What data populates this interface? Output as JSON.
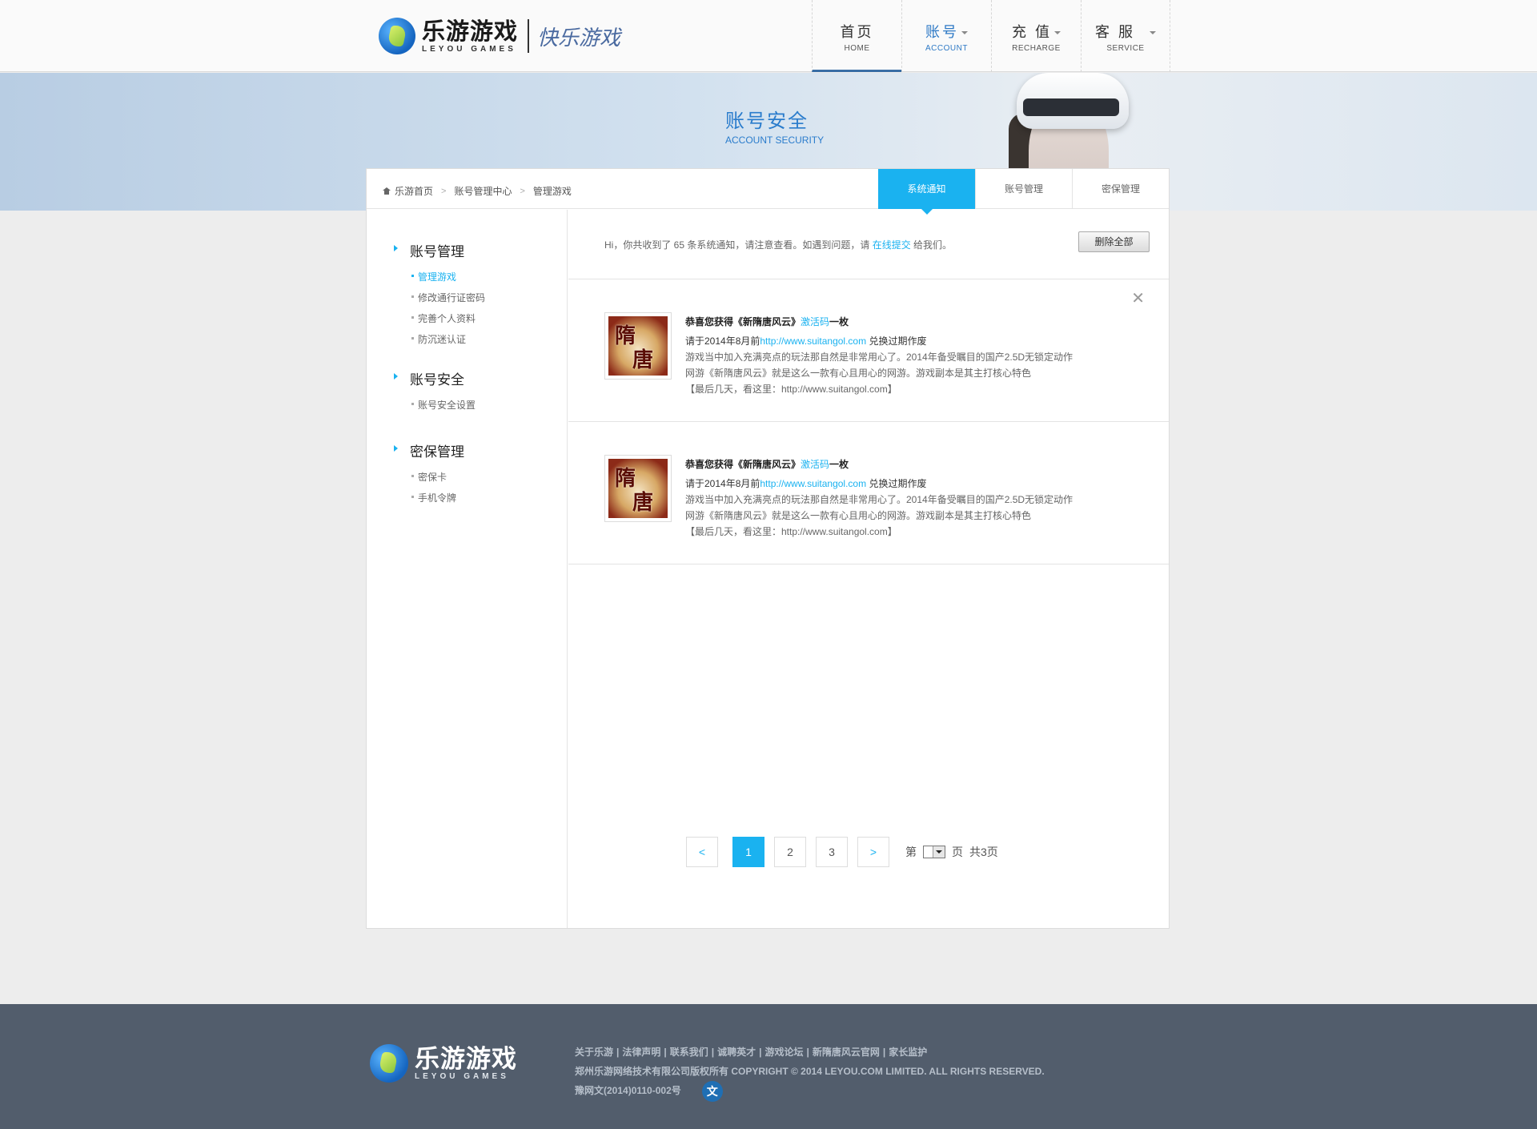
{
  "header": {
    "logo_cn": "乐游游戏",
    "logo_en": "LEYOU GAMES",
    "slogan": "快乐游戏",
    "nav": [
      {
        "cn": "首页",
        "en": "HOME"
      },
      {
        "cn": "账号",
        "en": "ACCOUNT"
      },
      {
        "cn": "充 值",
        "en": "RECHARGE"
      },
      {
        "cn": "客 服",
        "en": "SERVICE"
      }
    ]
  },
  "banner": {
    "title_cn": "账号安全",
    "title_en": "ACCOUNT SECURITY"
  },
  "breadcrumb": {
    "items": [
      "乐游首页",
      "账号管理中心",
      "管理游戏"
    ]
  },
  "tabs": [
    "系统通知",
    "账号管理",
    "密保管理"
  ],
  "sidebar": {
    "groups": [
      {
        "title": "账号管理",
        "items": [
          "管理游戏",
          "修改通行证密码",
          "完善个人资料",
          "防沉迷认证"
        ]
      },
      {
        "title": "账号安全",
        "items": [
          "账号安全设置"
        ]
      },
      {
        "title": "密保管理",
        "items": [
          "密保卡",
          "手机令牌"
        ]
      }
    ]
  },
  "notice": {
    "text_before": "Hi，你共收到了 65 条系统通知，请注意查看。如遇到问题，请 ",
    "link": "在线提交",
    "text_after": " 给我们。",
    "delete_all": "删除全部"
  },
  "messages": [
    {
      "title_before": "恭喜您获得《新隋唐风云》",
      "title_highlight": "激活码",
      "title_after": "一枚",
      "line1_before": "请于2014年8月前",
      "line1_link": "http://www.suitangol.com",
      "line1_after": " 兑换过期作废",
      "line2": "游戏当中加入充满亮点的玩法那自然是非常用心了。2014年备受瞩目的国产2.5D无锁定动作",
      "line3": "网游《新隋唐风云》就是这么一款有心且用心的网游。游戏副本是其主打核心特色",
      "line4": "【最后几天，看这里：http://www.suitangol.com】",
      "thumb_text_1": "隋",
      "thumb_text_2": "唐",
      "close": "✕"
    },
    {
      "title_before": "恭喜您获得《新隋唐风云》",
      "title_highlight": "激活码",
      "title_after": "一枚",
      "line1_before": "请于2014年8月前",
      "line1_link": "http://www.suitangol.com",
      "line1_after": " 兑换过期作废",
      "line2": "游戏当中加入充满亮点的玩法那自然是非常用心了。2014年备受瞩目的国产2.5D无锁定动作",
      "line3": "网游《新隋唐风云》就是这么一款有心且用心的网游。游戏副本是其主打核心特色",
      "line4": "【最后几天，看这里：http://www.suitangol.com】",
      "thumb_text_1": "隋",
      "thumb_text_2": "唐"
    }
  ],
  "pagination": {
    "prev": "<",
    "pages": [
      "1",
      "2",
      "3"
    ],
    "current": "1",
    "next": ">",
    "label_before": "第",
    "label_after": "页",
    "total": "共3页"
  },
  "footer": {
    "logo_cn": "乐游游戏",
    "logo_en": "LEYOU GAMES",
    "links": [
      "关于乐游",
      "法律声明",
      "联系我们",
      "诚聘英才",
      "游戏论坛",
      "新隋唐风云官网",
      "家长监护"
    ],
    "copyright": "郑州乐游网络技术有限公司版权所有 COPYRIGHT © 2014 LEYOU.COM LIMITED. ALL RIGHTS RESERVED.",
    "license": "豫网文(2014)0110-002号",
    "badge": "文"
  },
  "colors": {
    "accent": "#1ab2f0",
    "nav_accent": "#2f7ac6",
    "footer_bg": "#525d6c"
  }
}
